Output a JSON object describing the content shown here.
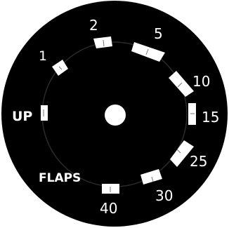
{
  "dial": {
    "title": "FLAPS",
    "detents": [
      {
        "id": "up",
        "label": "UP"
      },
      {
        "id": "1",
        "label": "1"
      },
      {
        "id": "2",
        "label": "2"
      },
      {
        "id": "5",
        "label": "5"
      },
      {
        "id": "10",
        "label": "10"
      },
      {
        "id": "15",
        "label": "15"
      },
      {
        "id": "25",
        "label": "25"
      },
      {
        "id": "30",
        "label": "30"
      },
      {
        "id": "40",
        "label": "40"
      }
    ],
    "colors": {
      "face": "#000000",
      "inner_ring": "#2a2a2a",
      "text": "#ffffff",
      "detent": "#ffffff",
      "hub": "#ffffff"
    }
  }
}
